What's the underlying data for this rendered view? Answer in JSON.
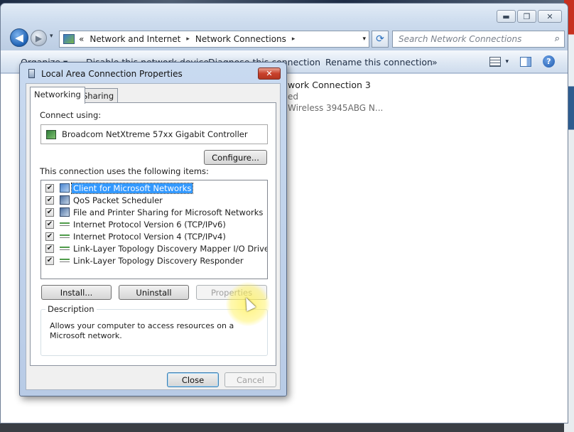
{
  "explorer": {
    "window_controls": {
      "minimize": "▬",
      "maximize": "❐",
      "close": "✕"
    },
    "nav": {
      "back": "◀",
      "forward": "▶",
      "history_dropdown": "▾"
    },
    "address": {
      "prefix": "«",
      "segments": [
        "Network and Internet",
        "Network Connections"
      ],
      "separator": "▸",
      "dropdown": "▾"
    },
    "refresh": "⟳",
    "search": {
      "placeholder": "Search Network Connections",
      "icon": "search-icon"
    },
    "command_bar": {
      "organize": "Organize ▾",
      "disable": "Disable this network device",
      "diagnose": "Diagnose this connection",
      "rename": "Rename this connection",
      "more": "»",
      "view_dropdown": "▾",
      "help": "?"
    },
    "connection": {
      "name": "work Connection 3",
      "status": "ed",
      "device": "Wireless 3945ABG N..."
    }
  },
  "dialog": {
    "title": "Local Area Connection Properties",
    "close": "✕",
    "tabs": [
      {
        "label": "Networking",
        "active": true
      },
      {
        "label": "Sharing",
        "active": false
      }
    ],
    "connect_using_label": "Connect using:",
    "adapter": "Broadcom NetXtreme 57xx Gigabit Controller",
    "configure_button": "Configure...",
    "items_label": "This connection uses the following items:",
    "items": [
      {
        "label": "Client for Microsoft Networks",
        "checked": true,
        "selected": true,
        "icon": "network-client-icon"
      },
      {
        "label": "QoS Packet Scheduler",
        "checked": true,
        "selected": false,
        "icon": "qos-service-icon"
      },
      {
        "label": "File and Printer Sharing for Microsoft Networks",
        "checked": true,
        "selected": false,
        "icon": "file-printer-sharing-icon"
      },
      {
        "label": "Internet Protocol Version 6 (TCP/IPv6)",
        "checked": true,
        "selected": false,
        "icon": "protocol-icon"
      },
      {
        "label": "Internet Protocol Version 4 (TCP/IPv4)",
        "checked": true,
        "selected": false,
        "icon": "protocol-icon"
      },
      {
        "label": "Link-Layer Topology Discovery Mapper I/O Driver",
        "checked": true,
        "selected": false,
        "icon": "protocol-icon"
      },
      {
        "label": "Link-Layer Topology Discovery Responder",
        "checked": true,
        "selected": false,
        "icon": "protocol-icon"
      }
    ],
    "check_mark": "✔",
    "buttons": {
      "install": "Install...",
      "uninstall": "Uninstall",
      "properties": "Properties"
    },
    "description_label": "Description",
    "description_text": "Allows your computer to access resources on a Microsoft network.",
    "footer": {
      "close": "Close",
      "cancel": "Cancel"
    }
  },
  "colors": {
    "selection": "#3399ff",
    "dialog_frame": "#c9daf0",
    "close_red": "#c9412b"
  }
}
